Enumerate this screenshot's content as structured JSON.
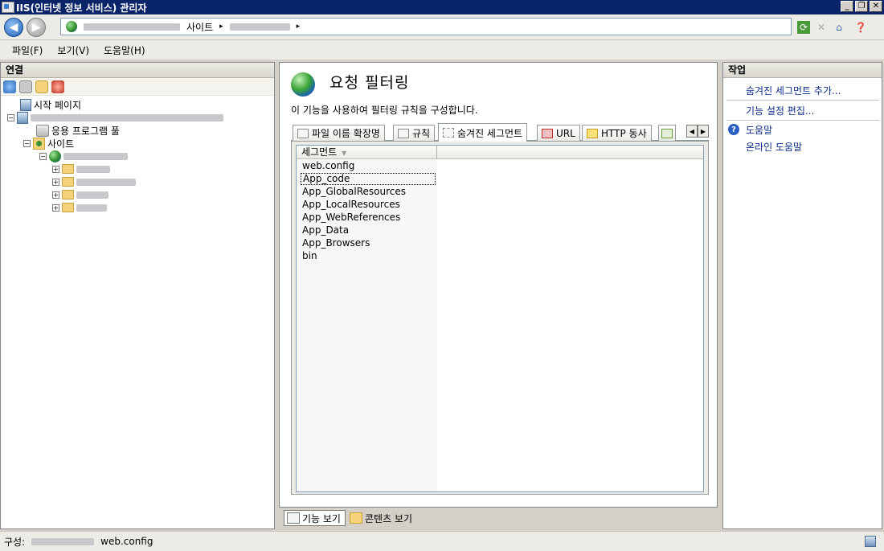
{
  "window": {
    "title": "IIS(인터넷 정보 서비스) 관리자",
    "minimize": "_",
    "restore": "❐",
    "close": "✕"
  },
  "address": {
    "crumb_site": "사이트",
    "sep": "▸"
  },
  "menu": {
    "file": "파일(F)",
    "view": "보기(V)",
    "help": "도움말(H)"
  },
  "connections": {
    "header": "연결",
    "tree": {
      "start_page": "시작 페이지",
      "app_pools": "응용 프로그램 풀",
      "sites": "사이트",
      "expand": "+",
      "collapse": "−"
    }
  },
  "feature": {
    "title": "요청 필터링",
    "description": "이 기능을 사용하여 필터링 규칙을 구성합니다.",
    "tabs": [
      "파일 이름 확장명",
      "규칙",
      "숨겨진 세그먼트",
      "URL",
      "HTTP 동사"
    ],
    "scroll_left": "◀",
    "scroll_right": "▶",
    "column_header": "세그먼트",
    "sort_glyph": "▼",
    "segments": [
      "web.config",
      "App_code",
      "App_GlobalResources",
      "App_LocalResources",
      "App_WebReferences",
      "App_Data",
      "App_Browsers",
      "bin"
    ]
  },
  "views": {
    "features": "기능 보기",
    "content": "콘텐츠 보기"
  },
  "actions": {
    "header": "작업",
    "add_hidden_segment": "숨겨진 세그먼트 추가...",
    "edit_feature_settings": "기능 설정 편집...",
    "help": "도움말",
    "online_help": "온라인 도움말",
    "help_glyph": "?"
  },
  "status": {
    "label": "구성:",
    "file": "web.config"
  },
  "colors": {
    "title_bar": "#0a246a",
    "link": "#0b2d8a"
  }
}
